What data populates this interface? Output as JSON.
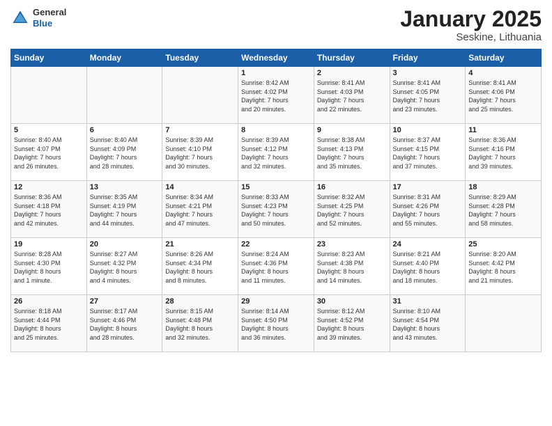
{
  "header": {
    "logo_general": "General",
    "logo_blue": "Blue",
    "title": "January 2025",
    "subtitle": "Seskine, Lithuania"
  },
  "days_of_week": [
    "Sunday",
    "Monday",
    "Tuesday",
    "Wednesday",
    "Thursday",
    "Friday",
    "Saturday"
  ],
  "weeks": [
    [
      {
        "day": "",
        "info": ""
      },
      {
        "day": "",
        "info": ""
      },
      {
        "day": "",
        "info": ""
      },
      {
        "day": "1",
        "info": "Sunrise: 8:42 AM\nSunset: 4:02 PM\nDaylight: 7 hours\nand 20 minutes."
      },
      {
        "day": "2",
        "info": "Sunrise: 8:41 AM\nSunset: 4:03 PM\nDaylight: 7 hours\nand 22 minutes."
      },
      {
        "day": "3",
        "info": "Sunrise: 8:41 AM\nSunset: 4:05 PM\nDaylight: 7 hours\nand 23 minutes."
      },
      {
        "day": "4",
        "info": "Sunrise: 8:41 AM\nSunset: 4:06 PM\nDaylight: 7 hours\nand 25 minutes."
      }
    ],
    [
      {
        "day": "5",
        "info": "Sunrise: 8:40 AM\nSunset: 4:07 PM\nDaylight: 7 hours\nand 26 minutes."
      },
      {
        "day": "6",
        "info": "Sunrise: 8:40 AM\nSunset: 4:09 PM\nDaylight: 7 hours\nand 28 minutes."
      },
      {
        "day": "7",
        "info": "Sunrise: 8:39 AM\nSunset: 4:10 PM\nDaylight: 7 hours\nand 30 minutes."
      },
      {
        "day": "8",
        "info": "Sunrise: 8:39 AM\nSunset: 4:12 PM\nDaylight: 7 hours\nand 32 minutes."
      },
      {
        "day": "9",
        "info": "Sunrise: 8:38 AM\nSunset: 4:13 PM\nDaylight: 7 hours\nand 35 minutes."
      },
      {
        "day": "10",
        "info": "Sunrise: 8:37 AM\nSunset: 4:15 PM\nDaylight: 7 hours\nand 37 minutes."
      },
      {
        "day": "11",
        "info": "Sunrise: 8:36 AM\nSunset: 4:16 PM\nDaylight: 7 hours\nand 39 minutes."
      }
    ],
    [
      {
        "day": "12",
        "info": "Sunrise: 8:36 AM\nSunset: 4:18 PM\nDaylight: 7 hours\nand 42 minutes."
      },
      {
        "day": "13",
        "info": "Sunrise: 8:35 AM\nSunset: 4:19 PM\nDaylight: 7 hours\nand 44 minutes."
      },
      {
        "day": "14",
        "info": "Sunrise: 8:34 AM\nSunset: 4:21 PM\nDaylight: 7 hours\nand 47 minutes."
      },
      {
        "day": "15",
        "info": "Sunrise: 8:33 AM\nSunset: 4:23 PM\nDaylight: 7 hours\nand 50 minutes."
      },
      {
        "day": "16",
        "info": "Sunrise: 8:32 AM\nSunset: 4:25 PM\nDaylight: 7 hours\nand 52 minutes."
      },
      {
        "day": "17",
        "info": "Sunrise: 8:31 AM\nSunset: 4:26 PM\nDaylight: 7 hours\nand 55 minutes."
      },
      {
        "day": "18",
        "info": "Sunrise: 8:29 AM\nSunset: 4:28 PM\nDaylight: 7 hours\nand 58 minutes."
      }
    ],
    [
      {
        "day": "19",
        "info": "Sunrise: 8:28 AM\nSunset: 4:30 PM\nDaylight: 8 hours\nand 1 minute."
      },
      {
        "day": "20",
        "info": "Sunrise: 8:27 AM\nSunset: 4:32 PM\nDaylight: 8 hours\nand 4 minutes."
      },
      {
        "day": "21",
        "info": "Sunrise: 8:26 AM\nSunset: 4:34 PM\nDaylight: 8 hours\nand 8 minutes."
      },
      {
        "day": "22",
        "info": "Sunrise: 8:24 AM\nSunset: 4:36 PM\nDaylight: 8 hours\nand 11 minutes."
      },
      {
        "day": "23",
        "info": "Sunrise: 8:23 AM\nSunset: 4:38 PM\nDaylight: 8 hours\nand 14 minutes."
      },
      {
        "day": "24",
        "info": "Sunrise: 8:21 AM\nSunset: 4:40 PM\nDaylight: 8 hours\nand 18 minutes."
      },
      {
        "day": "25",
        "info": "Sunrise: 8:20 AM\nSunset: 4:42 PM\nDaylight: 8 hours\nand 21 minutes."
      }
    ],
    [
      {
        "day": "26",
        "info": "Sunrise: 8:18 AM\nSunset: 4:44 PM\nDaylight: 8 hours\nand 25 minutes."
      },
      {
        "day": "27",
        "info": "Sunrise: 8:17 AM\nSunset: 4:46 PM\nDaylight: 8 hours\nand 28 minutes."
      },
      {
        "day": "28",
        "info": "Sunrise: 8:15 AM\nSunset: 4:48 PM\nDaylight: 8 hours\nand 32 minutes."
      },
      {
        "day": "29",
        "info": "Sunrise: 8:14 AM\nSunset: 4:50 PM\nDaylight: 8 hours\nand 36 minutes."
      },
      {
        "day": "30",
        "info": "Sunrise: 8:12 AM\nSunset: 4:52 PM\nDaylight: 8 hours\nand 39 minutes."
      },
      {
        "day": "31",
        "info": "Sunrise: 8:10 AM\nSunset: 4:54 PM\nDaylight: 8 hours\nand 43 minutes."
      },
      {
        "day": "",
        "info": ""
      }
    ]
  ]
}
